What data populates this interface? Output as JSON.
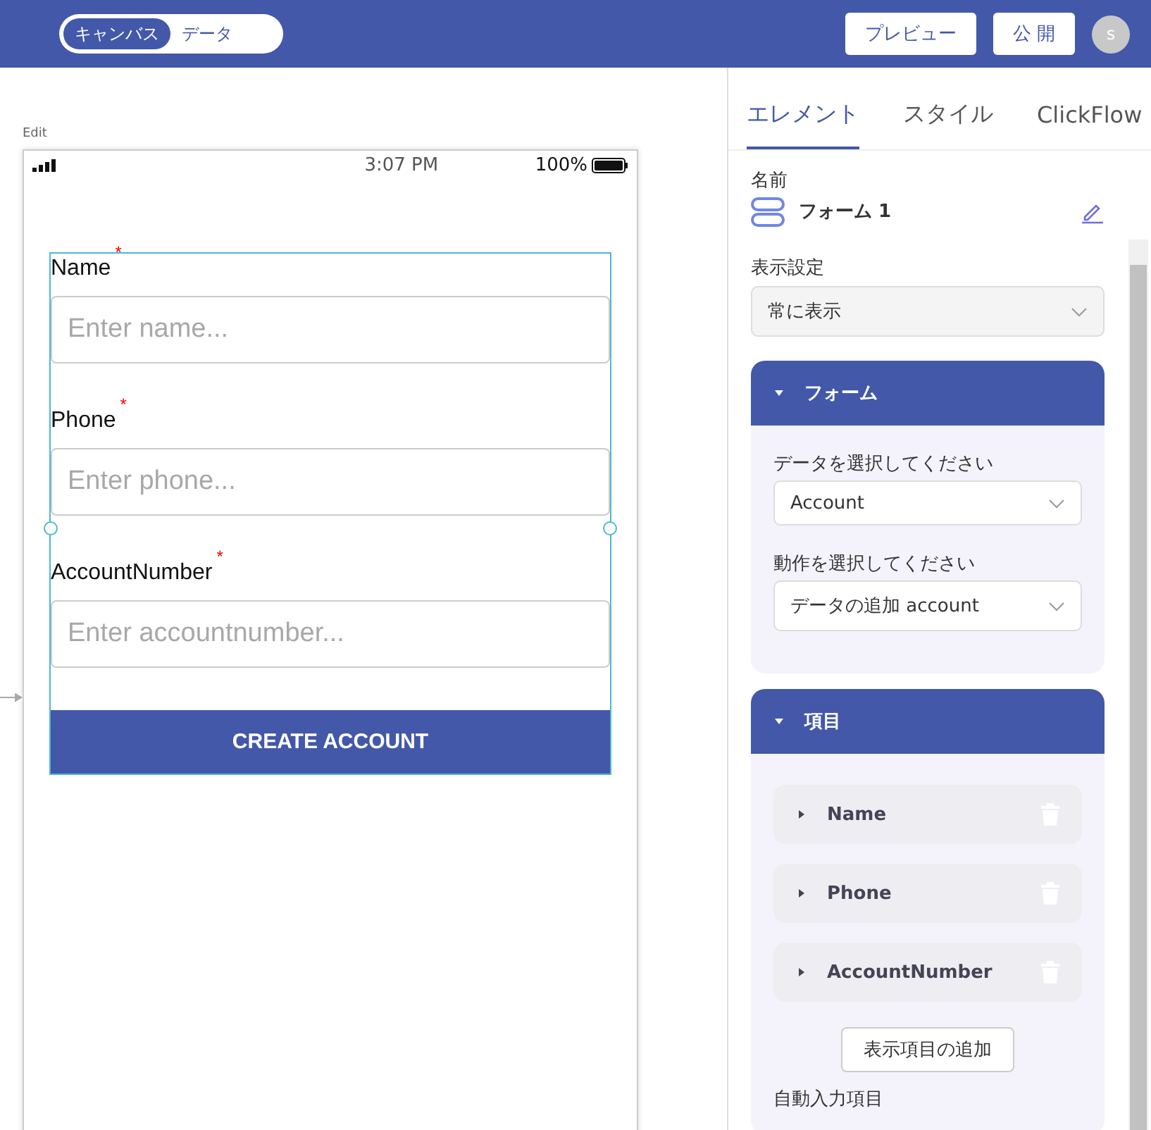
{
  "topbar": {
    "mode_toggle": [
      {
        "label": "キャンバス",
        "selected": true
      },
      {
        "label": "データ",
        "selected": false
      }
    ],
    "preview_button": "プレビュー",
    "publish_button": "公 開",
    "avatar": "s"
  },
  "canvas": {
    "label": "Edit",
    "status_bar": {
      "time": "3:07 PM",
      "battery": "100%"
    },
    "form": {
      "fields": [
        {
          "label": "Name",
          "required_mark": "*",
          "placeholder": "Enter name..."
        },
        {
          "label": "Phone",
          "required_mark": "*",
          "placeholder": "Enter phone..."
        },
        {
          "label": "AccountNumber",
          "required_mark": "*",
          "placeholder": "Enter accountnumber..."
        }
      ],
      "submit_button": "CREATE ACCOUNT",
      "selected": true
    }
  },
  "panel": {
    "tabs": [
      {
        "label": "エレメント",
        "selected": true
      },
      {
        "label": "スタイル",
        "selected": false
      },
      {
        "label": "ClickFlow",
        "selected": false
      }
    ],
    "name_label": "名前",
    "name_value": "フォーム 1",
    "visibility_label": "表示設定",
    "visibility_value": "常に表示",
    "form_section": {
      "title": "フォーム",
      "expanded": true,
      "data_label": "データを選択してください",
      "data_value": "Account",
      "action_label": "動作を選択してください",
      "action_value": "データの追加 account"
    },
    "items_section": {
      "title": "項目",
      "expanded": true,
      "items": [
        {
          "label": "Name",
          "expanded": false
        },
        {
          "label": "Phone",
          "expanded": false
        },
        {
          "label": "AccountNumber",
          "expanded": false
        }
      ],
      "add_button": "表示項目の追加"
    },
    "autofill_label": "自動入力項目"
  }
}
